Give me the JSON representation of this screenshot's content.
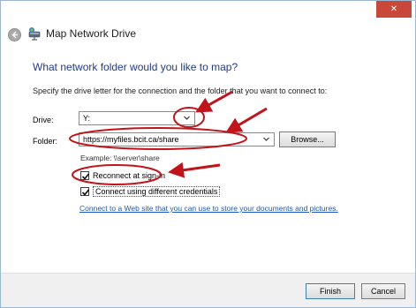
{
  "window": {
    "title": "Map Network Drive",
    "close_glyph": "✕"
  },
  "main": {
    "heading": "What network folder would you like to map?",
    "instructions": "Specify the drive letter for the connection and the folder that you want to connect to:",
    "drive": {
      "label": "Drive:",
      "value": "Y:"
    },
    "folder": {
      "label": "Folder:",
      "value": "https://myfiles.bcit.ca/share",
      "browse_label": "Browse..."
    },
    "example": "Example: \\\\server\\share",
    "reconnect": {
      "label": "Reconnect at sign-in",
      "checked": true
    },
    "different_credentials": {
      "label": "Connect using different credentials",
      "checked": true
    },
    "web_link": "Connect to a Web site that you can use to store your documents and pictures."
  },
  "footer": {
    "finish_label": "Finish",
    "cancel_label": "Cancel"
  },
  "colors": {
    "heading": "#1e3a8a",
    "link": "#1c56b8",
    "annotation": "#c0141a",
    "close_button": "#c9483a"
  },
  "icons": [
    "back-arrow-icon",
    "network-drive-icon",
    "close-icon",
    "chevron-down-icon",
    "checkmark-icon"
  ]
}
